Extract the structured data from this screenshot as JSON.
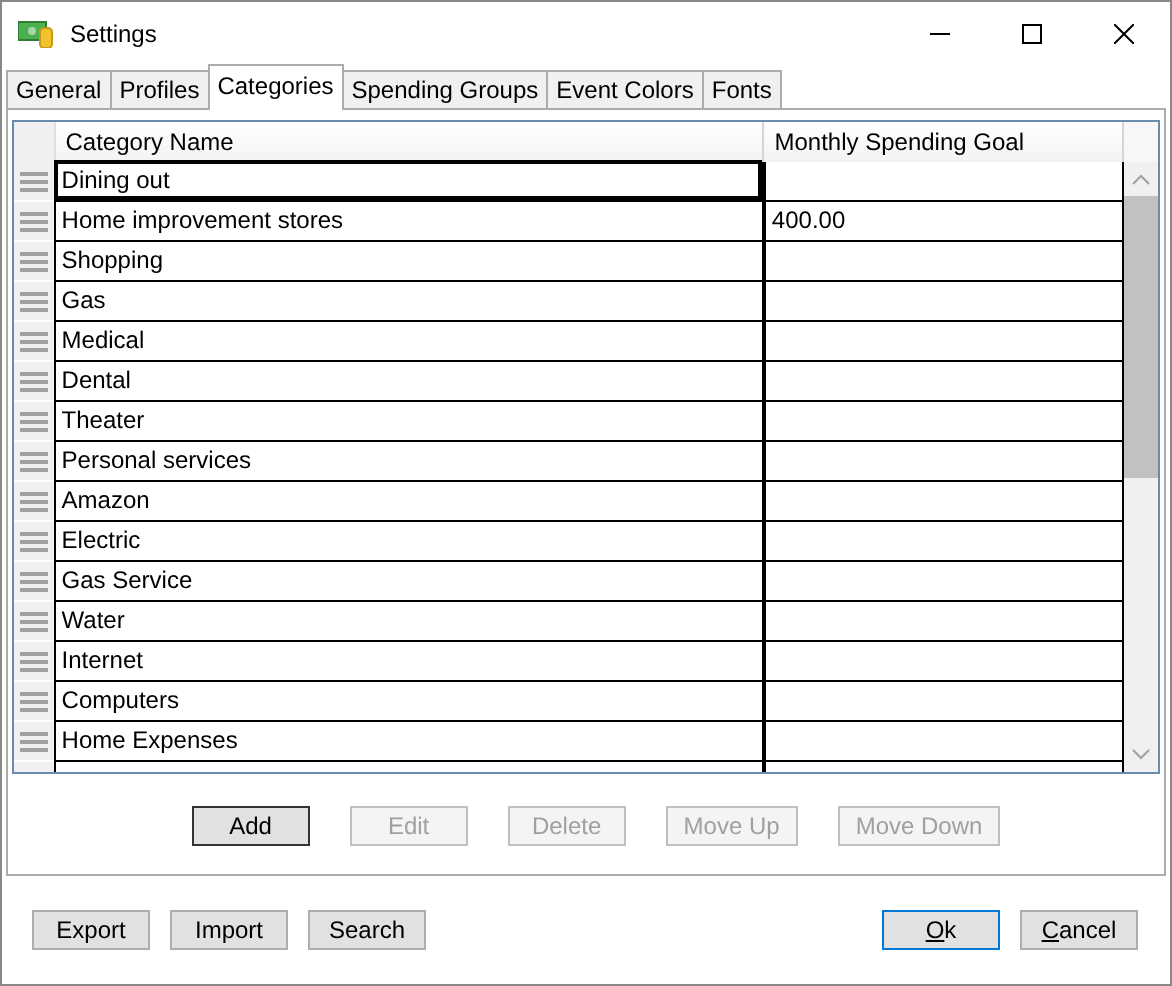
{
  "window": {
    "title": "Settings"
  },
  "tabs": [
    {
      "label": "General",
      "selected": false
    },
    {
      "label": "Profiles",
      "selected": false
    },
    {
      "label": "Categories",
      "selected": true
    },
    {
      "label": "Spending Groups",
      "selected": false
    },
    {
      "label": "Event Colors",
      "selected": false
    },
    {
      "label": "Fonts",
      "selected": false
    }
  ],
  "table": {
    "columns": [
      "Category Name",
      "Monthly Spending Goal"
    ],
    "rows": [
      {
        "name": "Dining out",
        "goal": "",
        "focused": true
      },
      {
        "name": "Home improvement stores",
        "goal": "400.00",
        "focused": false
      },
      {
        "name": "Shopping",
        "goal": "",
        "focused": false
      },
      {
        "name": "Gas",
        "goal": "",
        "focused": false
      },
      {
        "name": "Medical",
        "goal": "",
        "focused": false
      },
      {
        "name": "Dental",
        "goal": "",
        "focused": false
      },
      {
        "name": "Theater",
        "goal": "",
        "focused": false
      },
      {
        "name": "Personal services",
        "goal": "",
        "focused": false
      },
      {
        "name": "Amazon",
        "goal": "",
        "focused": false
      },
      {
        "name": "Electric",
        "goal": "",
        "focused": false
      },
      {
        "name": "Gas Service",
        "goal": "",
        "focused": false
      },
      {
        "name": "Water",
        "goal": "",
        "focused": false
      },
      {
        "name": "Internet",
        "goal": "",
        "focused": false
      },
      {
        "name": "Computers",
        "goal": "",
        "focused": false
      },
      {
        "name": "Home Expenses",
        "goal": "",
        "focused": false
      }
    ]
  },
  "row_buttons": [
    {
      "label": "Add",
      "disabled": false
    },
    {
      "label": "Edit",
      "disabled": true
    },
    {
      "label": "Delete",
      "disabled": true
    },
    {
      "label": "Move Up",
      "disabled": true
    },
    {
      "label": "Move Down",
      "disabled": true
    }
  ],
  "left_buttons": [
    {
      "label": "Export"
    },
    {
      "label": "Import"
    },
    {
      "label": "Search"
    }
  ],
  "right_buttons": [
    {
      "label": "Ok",
      "default": true,
      "accelerator": true
    },
    {
      "label": "Cancel",
      "default": false,
      "accelerator": true
    }
  ]
}
